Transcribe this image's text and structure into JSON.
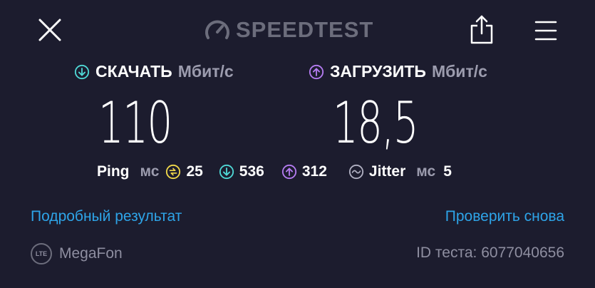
{
  "header": {
    "logo_text": "SPEEDTEST",
    "close_icon": "close-icon",
    "share_icon": "share-icon",
    "menu_icon": "menu-icon"
  },
  "download": {
    "label": "СКАЧАТЬ",
    "unit": "Мбит/с",
    "value": "110",
    "icon": "download-arrow-icon",
    "color": "#4fd8d6"
  },
  "upload": {
    "label": "ЗАГРУЗИТЬ",
    "unit": "Мбит/с",
    "value": "18,5",
    "icon": "upload-arrow-icon",
    "color": "#b57cf2"
  },
  "stats": {
    "ping_label": "Ping",
    "ping_unit": "мс",
    "ping_idle": "25",
    "ping_download": "536",
    "ping_upload": "312",
    "jitter_label": "Jitter",
    "jitter_unit": "мс",
    "jitter_value": "5",
    "ping_color": "#f2d94a"
  },
  "links": {
    "detailed": "Подробный результат",
    "retest": "Проверить снова",
    "color": "#2ea4e8"
  },
  "footer": {
    "network_badge": "LTE",
    "provider": "MegaFon",
    "test_id": "ID теста: 6077040656"
  }
}
